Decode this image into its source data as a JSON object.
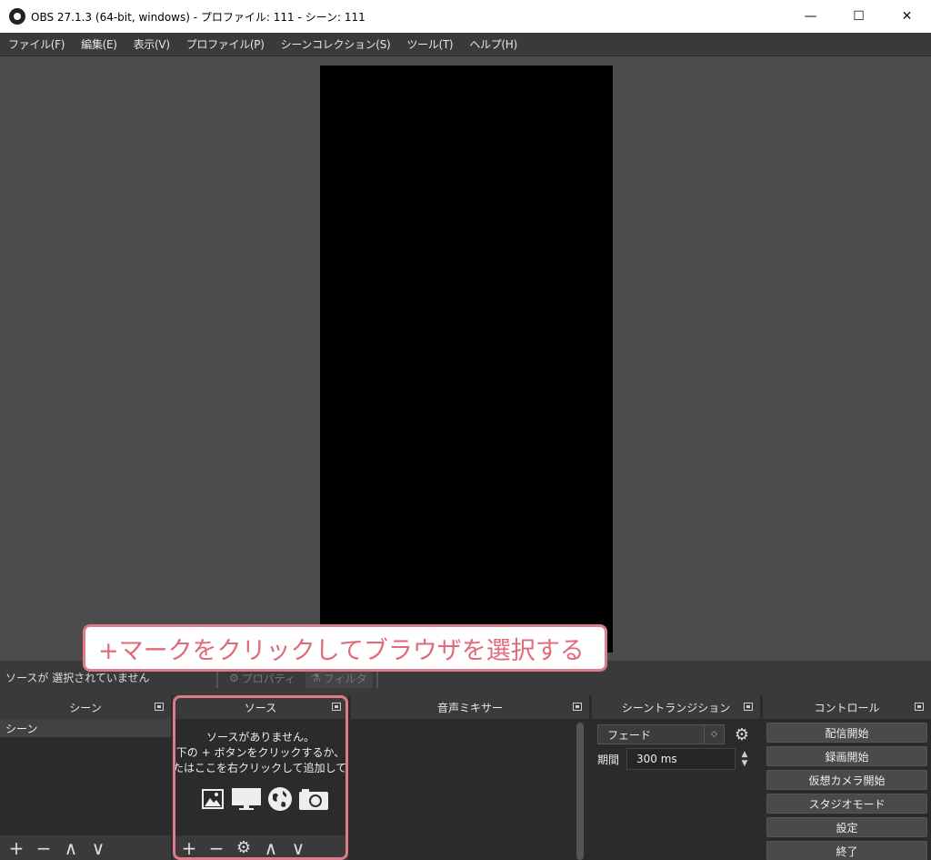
{
  "window": {
    "title": "OBS 27.1.3 (64-bit, windows) - プロファイル: 111 - シーン: 111",
    "minimize": "—",
    "maximize": "☐",
    "close": "✕"
  },
  "menu": [
    "ファイル(F)",
    "編集(E)",
    "表示(V)",
    "プロファイル(P)",
    "シーンコレクション(S)",
    "ツール(T)",
    "ヘルプ(H)"
  ],
  "context_bar": {
    "status": "ソースが 選択されていません",
    "properties": "プロパティ",
    "filters": "フィルタ"
  },
  "annotation": "+マークをクリックしてブラウザを選択する",
  "scenes": {
    "title": "シーン",
    "items": [
      "シーン"
    ]
  },
  "sources": {
    "title": "ソース",
    "empty_line1": "ソースがありません。",
    "empty_line2": "下の + ボタンをクリックするか、",
    "empty_line3": "たはここを右クリックして追加してくださ"
  },
  "mixer": {
    "title": "音声ミキサー"
  },
  "transitions": {
    "title": "シーントランジション",
    "selected": "フェード",
    "duration_label": "期間",
    "duration_value": "300 ms"
  },
  "controls": {
    "title": "コントロール",
    "buttons": [
      "配信開始",
      "録画開始",
      "仮想カメラ開始",
      "スタジオモード",
      "設定",
      "終了"
    ]
  },
  "toolbar_glyphs": {
    "add": "+",
    "remove": "−",
    "up": "∧",
    "down": "∨",
    "settings": "⚙"
  }
}
